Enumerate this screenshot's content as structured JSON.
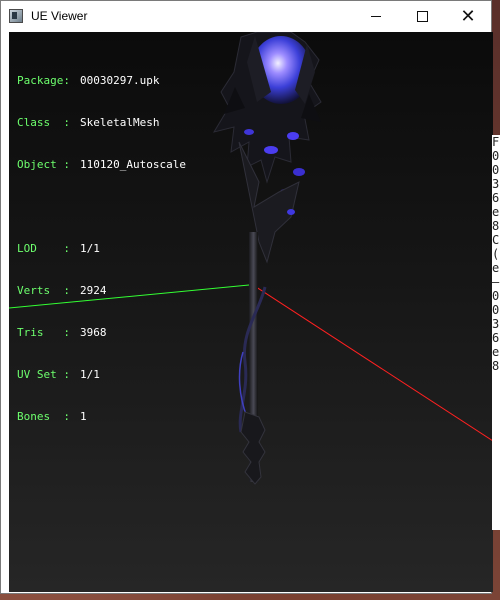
{
  "window": {
    "title": "UE Viewer",
    "buttons": {
      "minimize": "",
      "maximize": "",
      "close": "✕"
    }
  },
  "info": {
    "package": {
      "key": "Package:",
      "value": "00030297.upk"
    },
    "class": {
      "key": "Class  :",
      "value": "SkeletalMesh"
    },
    "object": {
      "key": "Object :",
      "value": "110120_Autoscale"
    },
    "lod": {
      "key": "LOD    :",
      "value": "1/1"
    },
    "verts": {
      "key": "Verts  :",
      "value": "2924"
    },
    "tris": {
      "key": "Tris   :",
      "value": "3968"
    },
    "uvset": {
      "key": "UV Set :",
      "value": "1/1"
    },
    "bones": {
      "key": "Bones  :",
      "value": "1"
    }
  },
  "colors": {
    "axis_x": "#ff2020",
    "axis_y": "#33ff33",
    "info_key": "#6dff6d",
    "info_value": "#ffffff"
  },
  "background_window_fragments": [
    "F",
    "0",
    "0",
    "3",
    "",
    "6",
    "e",
    "8",
    "",
    "C",
    "(",
    "e",
    "–",
    "",
    "0",
    "0",
    "3",
    "",
    "6",
    "e",
    "8"
  ]
}
